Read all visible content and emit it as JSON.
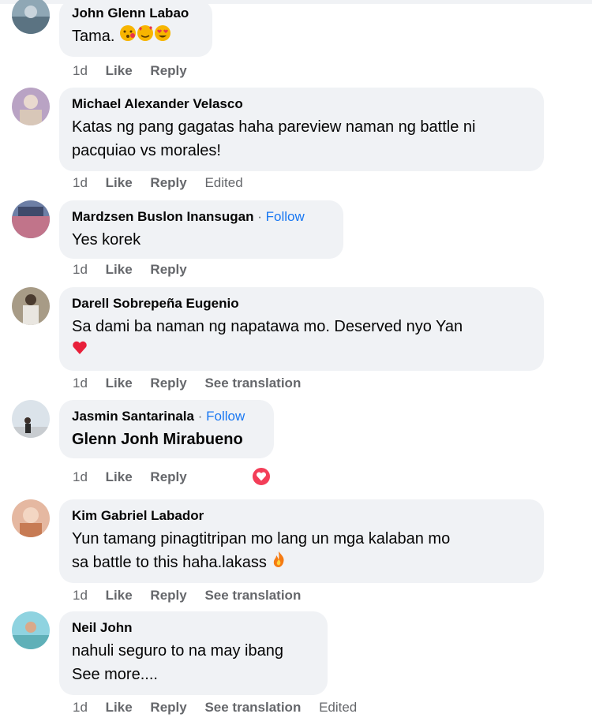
{
  "colors": {
    "bubble": "#f0f2f5",
    "link": "#1877f2",
    "meta": "#65676b",
    "love": "#f33e58"
  },
  "comments": [
    {
      "author": "John Glenn Labao",
      "text": "Tama.",
      "time": "1d",
      "like": "Like",
      "reply": "Reply",
      "emojis": [
        "smiling-kiss-emoji",
        "smiling-hearts-emoji",
        "heart-eyes-emoji"
      ]
    },
    {
      "author": "Michael Alexander Velasco",
      "line1": "Katas ng pang gagatas haha pareview naman ng battle ni",
      "line2": "pacquiao vs morales!",
      "time": "1d",
      "like": "Like",
      "reply": "Reply",
      "edited": "Edited"
    },
    {
      "author": "Mardzsen Buslon Inansugan",
      "sep": "·",
      "follow": "Follow",
      "text": "Yes korek",
      "time": "1d",
      "like": "Like",
      "reply": "Reply"
    },
    {
      "author": "Darell Sobrepeña Eugenio",
      "text": "Sa dami ba naman ng napatawa mo. Deserved nyo Yan",
      "time": "1d",
      "like": "Like",
      "reply": "Reply",
      "see_translation": "See translation",
      "emoji": "red-heart-emoji"
    },
    {
      "author": "Jasmin Santarinala",
      "sep": "·",
      "follow": "Follow",
      "mention": "Glenn Jonh Mirabueno",
      "time": "1d",
      "like": "Like",
      "reply": "Reply",
      "reaction": "love-reaction-icon"
    },
    {
      "author": "Kim Gabriel Labador",
      "line1": "Yun tamang pinagtitripan mo lang un mga kalaban mo",
      "line2": "sa battle to this haha.lakass",
      "time": "1d",
      "like": "Like",
      "reply": "Reply",
      "see_translation": "See translation",
      "emoji": "fire-emoji"
    },
    {
      "author": "Neil John",
      "line1": "nahuli seguro to na may ibang",
      "line2": "See more....",
      "time": "1d",
      "like": "Like",
      "reply": "Reply",
      "see_translation": "See translation",
      "edited": "Edited"
    }
  ]
}
